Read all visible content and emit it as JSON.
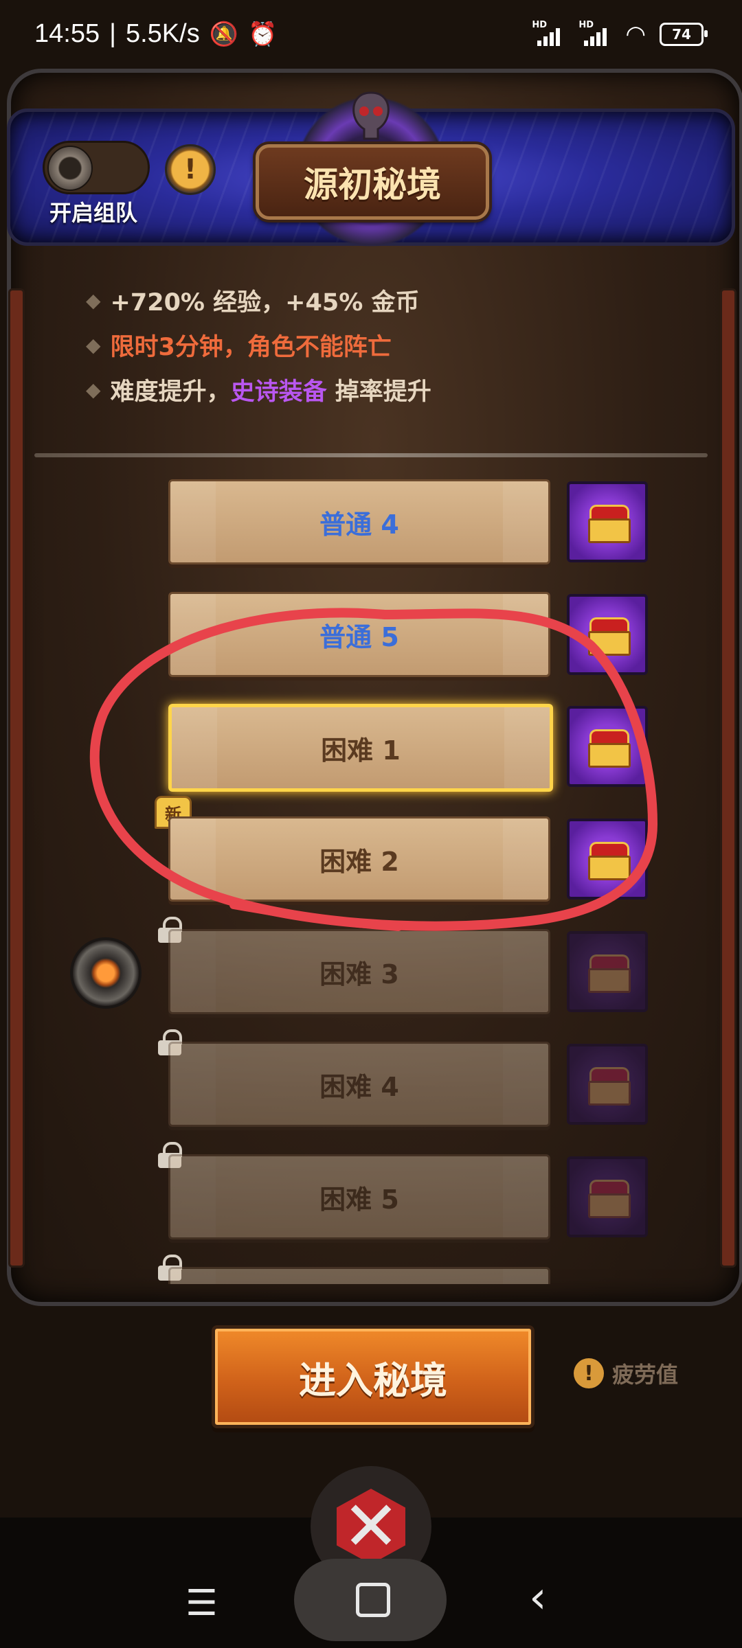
{
  "status_bar": {
    "time": "14:55",
    "net_speed": "5.5K/s",
    "signal_1": "HD",
    "signal_2": "HD",
    "battery": "74",
    "icons": [
      "silent-bell-icon",
      "alarm-icon",
      "signal-icon",
      "wifi-icon",
      "battery-icon"
    ]
  },
  "header": {
    "title": "源初秘境",
    "team_toggle_label": "开启组队",
    "info_icon": "!"
  },
  "bonuses": {
    "line1": "+720% 经验，+45% 金币",
    "line2": "限时3分钟，角色不能阵亡",
    "line3_pre": "难度提升，",
    "line3_epic": "史诗装备",
    "line3_post": " 掉率提升"
  },
  "stages": [
    {
      "label": "普通 4",
      "state": "unlocked"
    },
    {
      "label": "普通 5",
      "state": "unlocked"
    },
    {
      "label": "困难 1",
      "state": "selected"
    },
    {
      "label": "困难 2",
      "state": "unlocked"
    },
    {
      "label": "困难 3",
      "state": "locked"
    },
    {
      "label": "困难 4",
      "state": "locked"
    },
    {
      "label": "困难 5",
      "state": "locked"
    }
  ],
  "new_badge": "新",
  "enter_button": "进入秘境",
  "fatigue_label": "疲劳值",
  "fatigue_icon": "!",
  "colors": {
    "accent_orange": "#d0621a",
    "epic_purple": "#b957f0",
    "warning_red": "#ef6b3c",
    "selected_gold": "#ffd54a",
    "header_blue": "#2a2b9a"
  }
}
